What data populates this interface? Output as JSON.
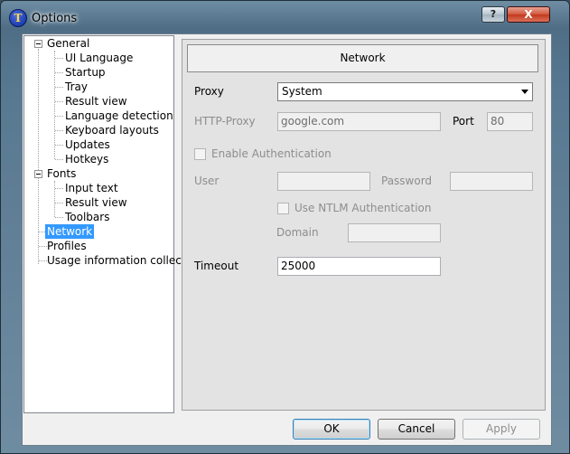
{
  "window": {
    "title": "Options",
    "help_label": "?",
    "close_label": "X"
  },
  "tree": {
    "general": "General",
    "ui_language": "UI Language",
    "startup": "Startup",
    "tray": "Tray",
    "result_view": "Result view",
    "language_detection": "Language detection",
    "keyboard_layouts": "Keyboard layouts",
    "updates": "Updates",
    "hotkeys": "Hotkeys",
    "fonts": "Fonts",
    "input_text": "Input text",
    "fonts_result_view": "Result view",
    "toolbars": "Toolbars",
    "network": "Network",
    "profiles": "Profiles",
    "usage": "Usage information collecting"
  },
  "network": {
    "header": "Network",
    "proxy_label": "Proxy",
    "proxy_value": "System",
    "http_proxy_label": "HTTP-Proxy",
    "http_proxy_value": "google.com",
    "port_label": "Port",
    "port_value": "80",
    "enable_auth_label": "Enable Authentication",
    "user_label": "User",
    "password_label": "Password",
    "ntlm_label": "Use NTLM Authentication",
    "domain_label": "Domain",
    "timeout_label": "Timeout",
    "timeout_value": "25000"
  },
  "buttons": {
    "ok": "OK",
    "cancel": "Cancel",
    "apply": "Apply"
  }
}
